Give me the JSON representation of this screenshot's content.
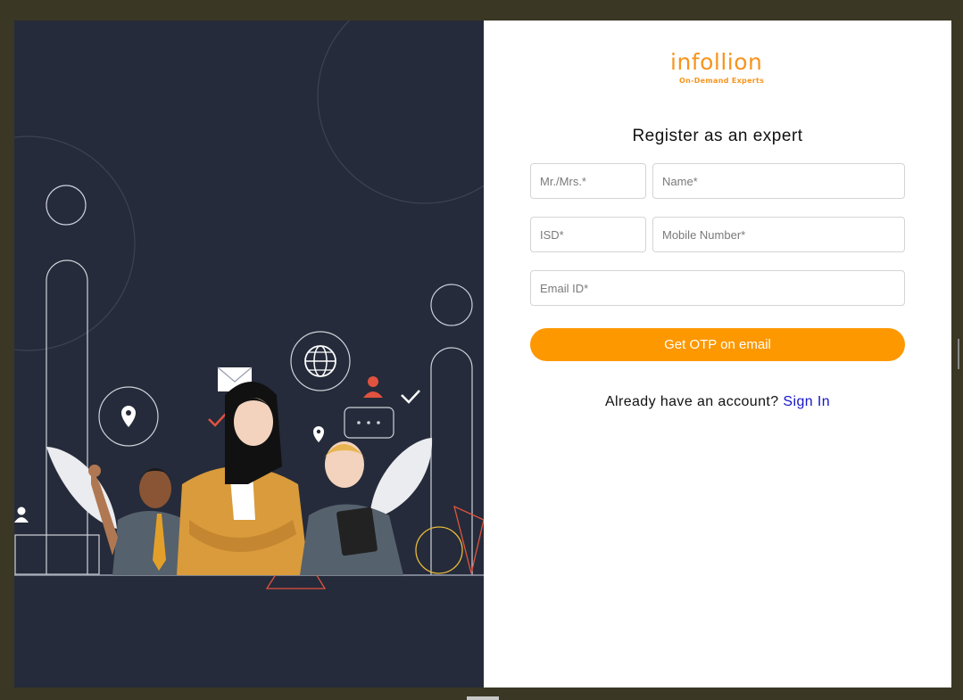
{
  "logo": {
    "wordmark": "infollion",
    "tagline": "On-Demand Experts"
  },
  "form": {
    "heading": "Register as an expert",
    "title_placeholder": "Mr./Mrs.*",
    "name_placeholder": "Name*",
    "isd_placeholder": "ISD*",
    "mobile_placeholder": "Mobile Number*",
    "email_placeholder": "Email ID*",
    "submit_label": "Get OTP on email",
    "signin_prompt": "Already have an account?",
    "signin_link": "Sign In"
  },
  "colors": {
    "accent": "#fd9800",
    "panel_bg": "#252b3a",
    "link": "#1515c9"
  }
}
